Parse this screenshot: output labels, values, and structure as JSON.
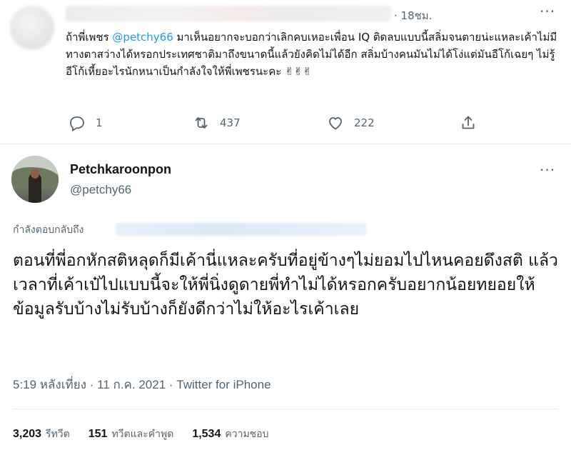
{
  "reply": {
    "time": "· 18ชม.",
    "text_before_mention": "ถ้าพี่เพชร ",
    "mention": "@petchy66",
    "text_after_mention": " มาเห็นอยากจะบอกว่าเลิกคบเหอะเพื่อน IQ ติดลบแบบนี้สลิ่มจนตายน่ะแหละเค้าไม่มีทางตาสว่างได้หรอกประเทศชาติมาถึงขนาดนี้แล้วยังคิดไม่ได้อีก สลิ่มบ้างคนมันไม่ได้โง่แต่มันอีโก้เฉยๆ ไม่รู้อีโก้เหี้ยอะไรนักหนาเป็นกำลังใจให้พี่เพชรนะคะ ✌✌✌",
    "actions": {
      "reply_count": "1",
      "retweet_count": "437",
      "like_count": "222"
    },
    "icons": [
      "reply-icon",
      "retweet-icon",
      "like-icon",
      "share-icon",
      "more-icon"
    ]
  },
  "tweet": {
    "display_name": "Petchkaroonpon",
    "handle": "@petchy66",
    "replying_to_label": "กำลังตอบกลับถึง",
    "text": "ตอนที่พี่อกหักสติหลุดก็มีเค้านี่แหละครับที่อยู่ข้างๆไม่ยอมไปไหนคอยดึงสติ แล้วเวลาที่เค้าเป๋ไปแบบนี้จะให้พี่นิ่งดูดายพี่ทำไม่ได้หรอกครับอยากน้อยทยอยให้ข้อมูลรับบ้างไม่รับบ้างก็ยังดีกว่าไม่ให้อะไรเค้าเลย",
    "meta": "5:19 หลังเที่ยง · 11 ก.ค. 2021 · Twitter for iPhone",
    "stats": {
      "retweets_num": "3,203",
      "retweets_label": "รีทวีต",
      "quotes_num": "151",
      "quotes_label": "ทวีตและคำพูด",
      "likes_num": "1,534",
      "likes_label": "ความชอบ"
    }
  },
  "colors": {
    "accent": "#1d9bf0",
    "secondary_text": "#536471",
    "primary_text": "#0f1419",
    "divider": "#e6ecf0"
  }
}
